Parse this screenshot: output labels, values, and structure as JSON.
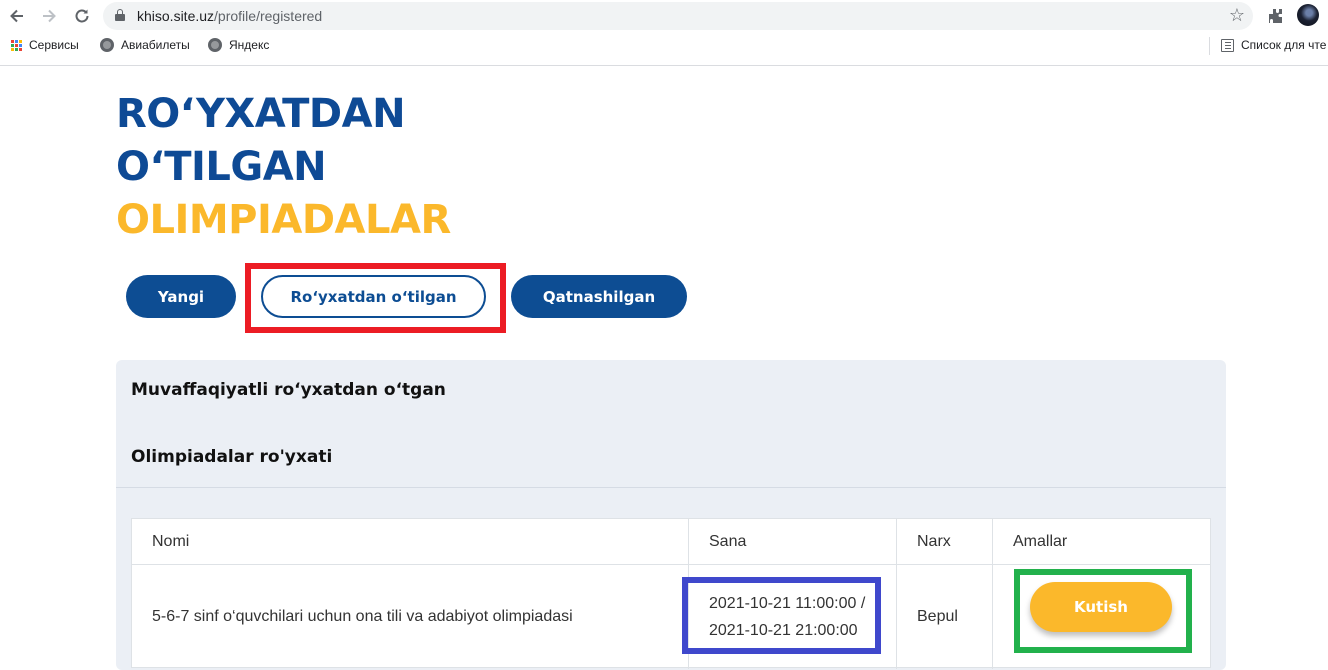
{
  "browser": {
    "url_domain": "khiso.site.uz",
    "url_path": "/profile/registered",
    "bookmarks": [
      {
        "label": "Сервисы"
      },
      {
        "label": "Авиабилеты"
      },
      {
        "label": "Яндекс"
      }
    ],
    "reading_list": "Список для чте"
  },
  "page": {
    "title_line1": "RO‘YXATDAN",
    "title_line2": "O‘TILGAN",
    "title_line3": "OLIMPIADALAR",
    "tabs": [
      {
        "label": "Yangi",
        "active": false
      },
      {
        "label": "Ro‘yxatdan o‘tilgan",
        "active": true
      },
      {
        "label": "Qatnashilgan",
        "active": false
      }
    ],
    "panel_heading": "Muvaffaqiyatli ro‘yxatdan o‘tgan",
    "list_heading": "Olimpiadalar ro'yxati"
  },
  "table": {
    "columns": [
      "Nomi",
      "Sana",
      "Narx",
      "Amallar"
    ],
    "rows": [
      {
        "name": "5-6-7 sinf o‘quvchilari uchun ona tili va adabiyot olimpiadasi",
        "date_start": "2021-10-21 11:00:00 /",
        "date_end": "2021-10-21 21:00:00",
        "price": "Bepul",
        "action": "Kutish"
      }
    ]
  },
  "colors": {
    "primary_blue": "#0d4d93",
    "accent_gold": "#fbb82b",
    "panel_bg": "#ebeff5",
    "highlight_red": "#ec1c24",
    "highlight_blue": "#3f48cc",
    "highlight_green": "#22b14c"
  },
  "icons": [
    "back-icon",
    "forward-icon",
    "reload-icon",
    "lock-icon",
    "star-icon",
    "extensions-icon",
    "apps-icon",
    "globe-icon",
    "reading-list-icon"
  ]
}
